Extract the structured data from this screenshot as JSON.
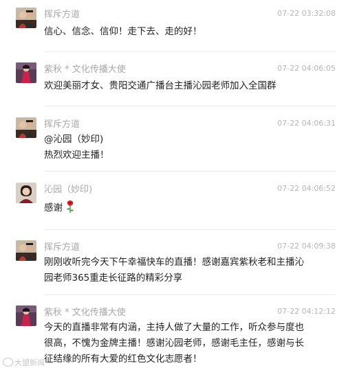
{
  "messages": [
    {
      "name": "挥斥方道",
      "time": "07-22 03:32:08",
      "avatar": "avatar-couple-photo",
      "lines": [
        "信心、信念、信仰！走下去、走的好！"
      ]
    },
    {
      "name": "紫秋 * 文化传播大使",
      "time": "07-22 04:06:05",
      "avatar": "avatar-woman-red-dress",
      "lines": [
        "欢迎美丽才女、贵阳交通广播台主播沁园老师加入全国群"
      ]
    },
    {
      "name": "挥斥方道",
      "time": "07-22 04:06:31",
      "avatar": "avatar-couple-photo",
      "lines": [
        "@沁园（妙印)",
        "热烈欢迎主播！"
      ]
    },
    {
      "name": "沁园（妙印)",
      "time": "07-22 04:06:52",
      "avatar": "avatar-woman-portrait",
      "lines": [
        "感谢"
      ],
      "emoji": "rose-emoji"
    },
    {
      "name": "挥斥方道",
      "time": "07-22 04:09:38",
      "avatar": "avatar-couple-photo",
      "lines": [
        "刚刚收听完今天下午幸福快车的直播！感谢嘉宾紫秋老和主播沁",
        "园老师365重走长征路的精彩分享"
      ]
    },
    {
      "name": "紫秋 * 文化传播大使",
      "time": "07-22 04:12:12",
      "avatar": "avatar-woman-red-dress",
      "lines": [
        "今天的直播非常有内涵，主持人做了大量的工作，听众参与度也",
        "很高，不愧为金牌主播！感谢沁园老师，感谢毛主任，感谢与长",
        "征结缘的所有大爱的红色文化志愿者！"
      ]
    }
  ],
  "watermark": "大盟新闻"
}
